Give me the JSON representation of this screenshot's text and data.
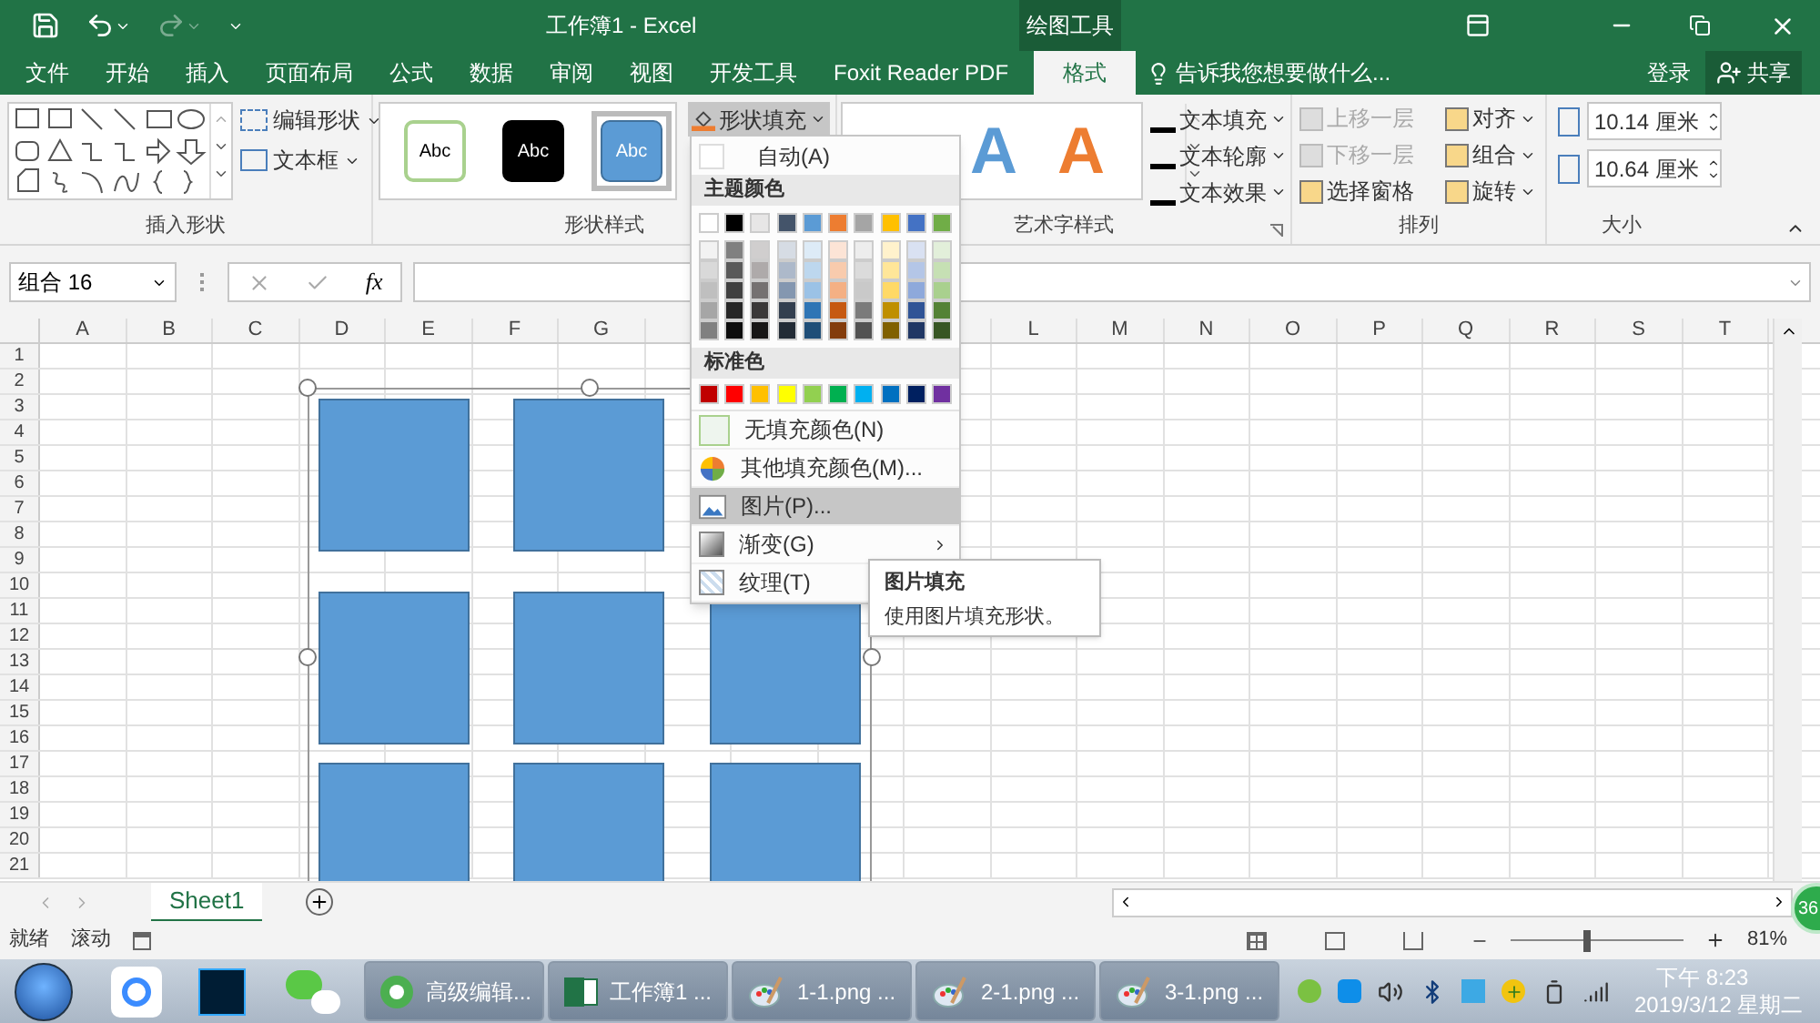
{
  "window": {
    "title": "工作簿1 - Excel",
    "context_group": "绘图工具"
  },
  "ribbon_tabs": [
    {
      "label": "文件",
      "selected": false
    },
    {
      "label": "开始",
      "selected": false
    },
    {
      "label": "插入",
      "selected": false
    },
    {
      "label": "页面布局",
      "selected": false
    },
    {
      "label": "公式",
      "selected": false
    },
    {
      "label": "数据",
      "selected": false
    },
    {
      "label": "审阅",
      "selected": false
    },
    {
      "label": "视图",
      "selected": false
    },
    {
      "label": "开发工具",
      "selected": false
    },
    {
      "label": "Foxit Reader PDF",
      "selected": false
    },
    {
      "label": "格式",
      "selected": true
    }
  ],
  "tell_me": {
    "placeholder": "告诉我您想要做什么..."
  },
  "account": {
    "sign_in": "登录",
    "share": "共享"
  },
  "insert_shapes": {
    "title": "插入形状",
    "buttons": [
      "编辑形状",
      "文本框"
    ]
  },
  "shape_styles": {
    "title": "形状样式",
    "presets": [
      {
        "label": "Abc",
        "kind": "outline",
        "selected": false
      },
      {
        "label": "Abc",
        "kind": "dark",
        "selected": false
      },
      {
        "label": "Abc",
        "kind": "blue",
        "selected": true
      }
    ],
    "fill_button": {
      "label": "形状填充",
      "expanded": true
    }
  },
  "wordart_styles": {
    "title": "艺术字样式",
    "samples": [
      {
        "label": "A",
        "color": "#5b9bd5"
      },
      {
        "label": "A",
        "color": "#ed7d31"
      }
    ],
    "buttons": [
      "文本填充",
      "文本轮廓",
      "文本效果"
    ]
  },
  "arrange": {
    "title": "排列",
    "buttons": [
      {
        "label": "上移一层",
        "disabled": true
      },
      {
        "label": "下移一层",
        "disabled": true
      },
      {
        "label": "选择窗格",
        "disabled": false
      },
      {
        "label": "对齐",
        "disabled": false
      },
      {
        "label": "组合",
        "disabled": false
      },
      {
        "label": "旋转",
        "disabled": false
      }
    ]
  },
  "size": {
    "title": "大小",
    "height": "10.14 厘米",
    "width": "10.64 厘米"
  },
  "formula_bar": {
    "name_box": "组合 16",
    "function_label": "fx"
  },
  "sheet": {
    "columns_left": [
      "A",
      "B",
      "C",
      "D",
      "E",
      "F",
      "G"
    ],
    "columns_right": [
      "L",
      "M",
      "N",
      "O",
      "P",
      "Q",
      "R",
      "S",
      "T"
    ],
    "rows": [
      "1",
      "2",
      "3",
      "4",
      "5",
      "6",
      "7",
      "8",
      "9",
      "10",
      "11",
      "12",
      "13",
      "14",
      "15",
      "16",
      "17",
      "18",
      "19",
      "20",
      "21"
    ]
  },
  "fill_menu": {
    "auto": "自动(A)",
    "theme_header": "主题颜色",
    "theme_colors": [
      {
        "color": "#ffffff",
        "shades": [
          {
            "color": "#f2f2f2"
          },
          {
            "color": "#d9d9d9"
          },
          {
            "color": "#bfbfbf"
          },
          {
            "color": "#a6a6a6"
          },
          {
            "color": "#808080"
          }
        ]
      },
      {
        "color": "#000000",
        "shades": [
          {
            "color": "#808080"
          },
          {
            "color": "#595959"
          },
          {
            "color": "#404040"
          },
          {
            "color": "#262626"
          },
          {
            "color": "#0d0d0d"
          }
        ]
      },
      {
        "color": "#e7e6e6",
        "shades": [
          {
            "color": "#d0cece"
          },
          {
            "color": "#aeaaaa"
          },
          {
            "color": "#757171"
          },
          {
            "color": "#3a3838"
          },
          {
            "color": "#171616"
          }
        ]
      },
      {
        "color": "#44546a",
        "shades": [
          {
            "color": "#d6dce4"
          },
          {
            "color": "#adb9ca"
          },
          {
            "color": "#8497b0"
          },
          {
            "color": "#333f4f"
          },
          {
            "color": "#222b35"
          }
        ]
      },
      {
        "color": "#5b9bd5",
        "shades": [
          {
            "color": "#ddebf7"
          },
          {
            "color": "#bdd7ee"
          },
          {
            "color": "#9bc2e6"
          },
          {
            "color": "#2f75b5"
          },
          {
            "color": "#1f4e78"
          }
        ]
      },
      {
        "color": "#ed7d31",
        "shades": [
          {
            "color": "#fce4d6"
          },
          {
            "color": "#f8cbad"
          },
          {
            "color": "#f4b084"
          },
          {
            "color": "#c65911"
          },
          {
            "color": "#833c0c"
          }
        ]
      },
      {
        "color": "#a5a5a5",
        "shades": [
          {
            "color": "#ededed"
          },
          {
            "color": "#dbdbdb"
          },
          {
            "color": "#c9c9c9"
          },
          {
            "color": "#7b7b7b"
          },
          {
            "color": "#525252"
          }
        ]
      },
      {
        "color": "#ffc000",
        "shades": [
          {
            "color": "#fff2cc"
          },
          {
            "color": "#ffe699"
          },
          {
            "color": "#ffd966"
          },
          {
            "color": "#bf8f00"
          },
          {
            "color": "#806000"
          }
        ]
      },
      {
        "color": "#4472c4",
        "shades": [
          {
            "color": "#d9e1f2"
          },
          {
            "color": "#b4c6e7"
          },
          {
            "color": "#8ea9db"
          },
          {
            "color": "#305496"
          },
          {
            "color": "#203764"
          }
        ]
      },
      {
        "color": "#70ad47",
        "shades": [
          {
            "color": "#e2efda"
          },
          {
            "color": "#c6e0b4"
          },
          {
            "color": "#a9d08e"
          },
          {
            "color": "#548235"
          },
          {
            "color": "#375623"
          }
        ]
      }
    ],
    "standard_header": "标准色",
    "standard_colors": [
      {
        "color": "#c00000"
      },
      {
        "color": "#ff0000"
      },
      {
        "color": "#ffc000"
      },
      {
        "color": "#ffff00"
      },
      {
        "color": "#92d050"
      },
      {
        "color": "#00b050"
      },
      {
        "color": "#00b0f0"
      },
      {
        "color": "#0070c0"
      },
      {
        "color": "#002060"
      },
      {
        "color": "#7030a0"
      }
    ],
    "items": [
      {
        "kind": "no_fill",
        "label": "无填充颜色(N)",
        "selected": false
      },
      {
        "kind": "more_colors",
        "label": "其他填充颜色(M)...",
        "selected": false
      },
      {
        "kind": "picture",
        "label": "图片(P)...",
        "selected": true
      },
      {
        "kind": "gradient",
        "label": "渐变(G)",
        "selected": false
      },
      {
        "kind": "texture",
        "label": "纹理(T)",
        "selected": false
      }
    ]
  },
  "tooltip": {
    "title": "图片填充",
    "text": "使用图片填充形状。"
  },
  "sheet_tabs": [
    {
      "label": "Sheet1",
      "selected": true
    }
  ],
  "status_bar": {
    "ready": "就绪",
    "scroll": "滚动",
    "zoom": "81%",
    "zoom_slider": {
      "level": 0.42
    }
  },
  "floating_ball": "36",
  "taskbar": {
    "tasks": [
      {
        "kind": "browser",
        "label": "高级编辑..."
      },
      {
        "kind": "excel",
        "label": "工作簿1 ..."
      },
      {
        "kind": "paint",
        "label": "1-1.png ..."
      },
      {
        "kind": "paint",
        "label": "2-1.png ..."
      },
      {
        "kind": "paint",
        "label": "3-1.png ..."
      }
    ],
    "time": "下午 8:23",
    "date": "2019/3/12 星期二"
  }
}
